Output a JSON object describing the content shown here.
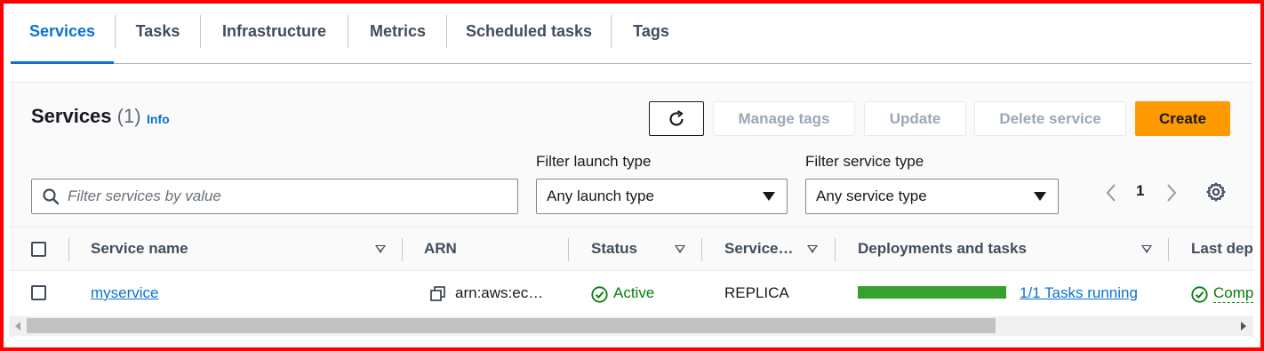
{
  "tabs": [
    {
      "label": "Services",
      "active": true
    },
    {
      "label": "Tasks"
    },
    {
      "label": "Infrastructure"
    },
    {
      "label": "Metrics"
    },
    {
      "label": "Scheduled tasks"
    },
    {
      "label": "Tags"
    }
  ],
  "services_panel": {
    "title": "Services",
    "count": "(1)",
    "info_label": "Info",
    "buttons": {
      "refresh_icon": "refresh-icon",
      "manage_tags": "Manage tags",
      "update": "Update",
      "delete_service": "Delete service",
      "create": "Create"
    },
    "search": {
      "placeholder": "Filter services by value",
      "icon": "search-icon"
    },
    "filter_launch_type": {
      "label": "Filter launch type",
      "value": "Any launch type"
    },
    "filter_service_type": {
      "label": "Filter service type",
      "value": "Any service type"
    },
    "pagination": {
      "current_page": "1"
    },
    "settings_icon": "gear-icon"
  },
  "table": {
    "columns": [
      "Service name",
      "ARN",
      "Status",
      "Service…",
      "Deployments and tasks",
      "Last dep"
    ],
    "rows": [
      {
        "service_name": "myservice",
        "arn": "arn:aws:ec…",
        "status": "Active",
        "service_type": "REPLICA",
        "deployment_progress": 1.0,
        "tasks": "1/1 Tasks running",
        "last_deployment": "Comp"
      }
    ]
  },
  "colors": {
    "accent": "#0972d3",
    "create_button": "#ff9900",
    "success": "#037f0c",
    "progress_bar": "#37a12e",
    "frame": "#ff0000"
  }
}
